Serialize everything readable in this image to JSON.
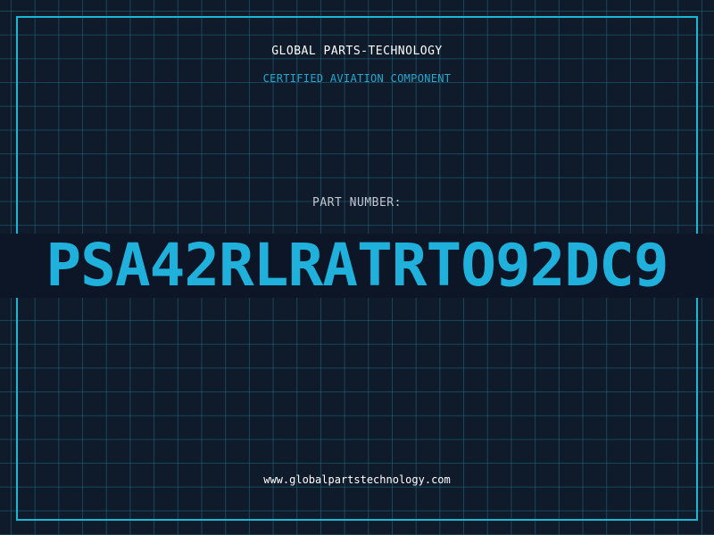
{
  "header": {
    "company": "GLOBAL PARTS-TECHNOLOGY",
    "tagline": "CERTIFIED AVIATION COMPONENT"
  },
  "part": {
    "label": "PART NUMBER:",
    "number": "PSA42RLRATRTO92DC9"
  },
  "footer": {
    "website": "www.globalpartstechnology.com"
  },
  "colors": {
    "background": "#0f1a2b",
    "grid": "#1e6e82",
    "accent": "#1fb1dc",
    "title": "#ffffff"
  }
}
